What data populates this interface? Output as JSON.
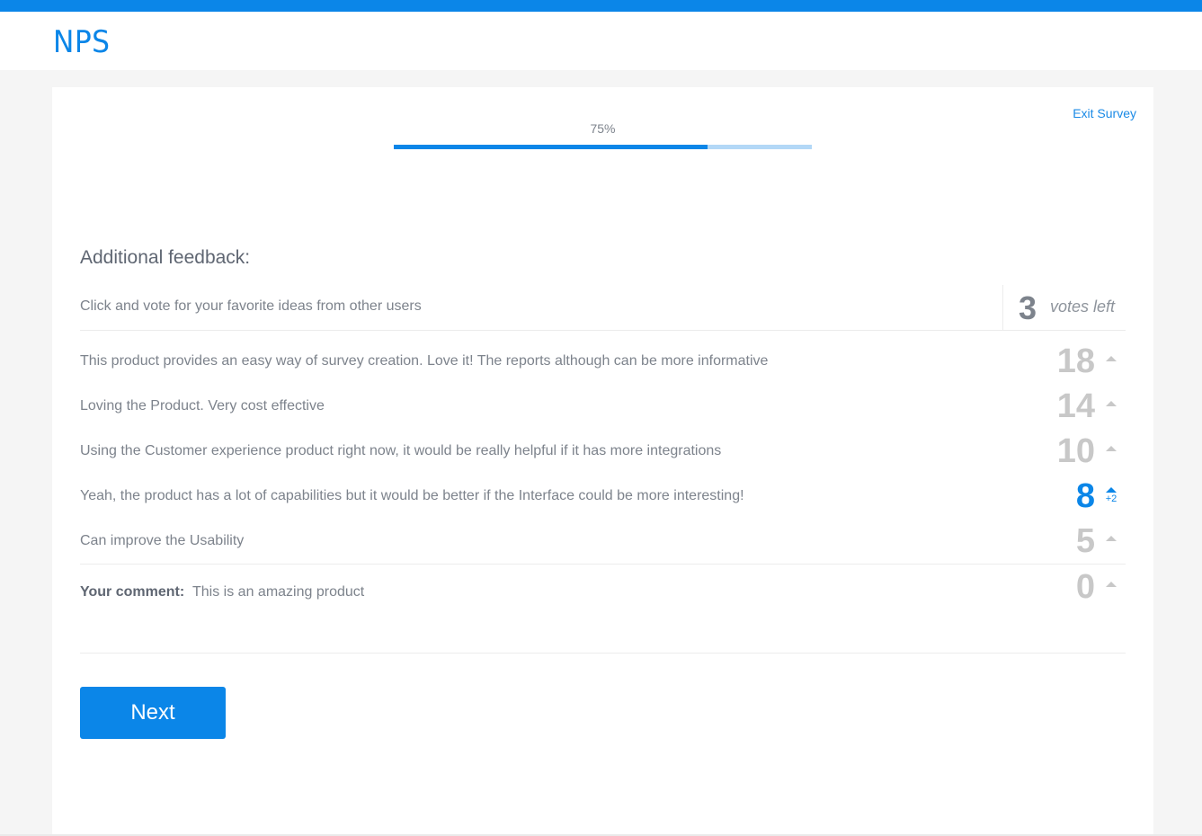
{
  "app": {
    "title": "NPS"
  },
  "colors": {
    "accent": "#0b86e8",
    "progress_track": "#b3d8f7",
    "muted_count": "#c8c8c8"
  },
  "survey": {
    "exit_label": "Exit Survey",
    "progress": {
      "label": "75%",
      "percent": 75
    }
  },
  "feedback": {
    "title": "Additional feedback:",
    "instruction": "Click and vote for your favorite ideas from other users",
    "votes_left": {
      "count": "3",
      "label": "votes left"
    },
    "ideas": [
      {
        "text": "This product provides an easy way of survey creation. Love it! The reports although can be more informative",
        "votes": "18",
        "voted": false,
        "delta": ""
      },
      {
        "text": "Loving the Product. Very cost effective",
        "votes": "14",
        "voted": false,
        "delta": ""
      },
      {
        "text": "Using the Customer experience product right now, it would be really helpful if it has more integrations",
        "votes": "10",
        "voted": false,
        "delta": ""
      },
      {
        "text": "Yeah, the product has a lot of capabilities but it would be better if the Interface could be more interesting!",
        "votes": "8",
        "voted": true,
        "delta": "+2"
      },
      {
        "text": "Can improve the Usability",
        "votes": "5",
        "voted": false,
        "delta": ""
      }
    ],
    "your_comment": {
      "label": "Your comment:",
      "text": "This is an amazing product",
      "votes": "0"
    }
  },
  "actions": {
    "next_label": "Next"
  }
}
